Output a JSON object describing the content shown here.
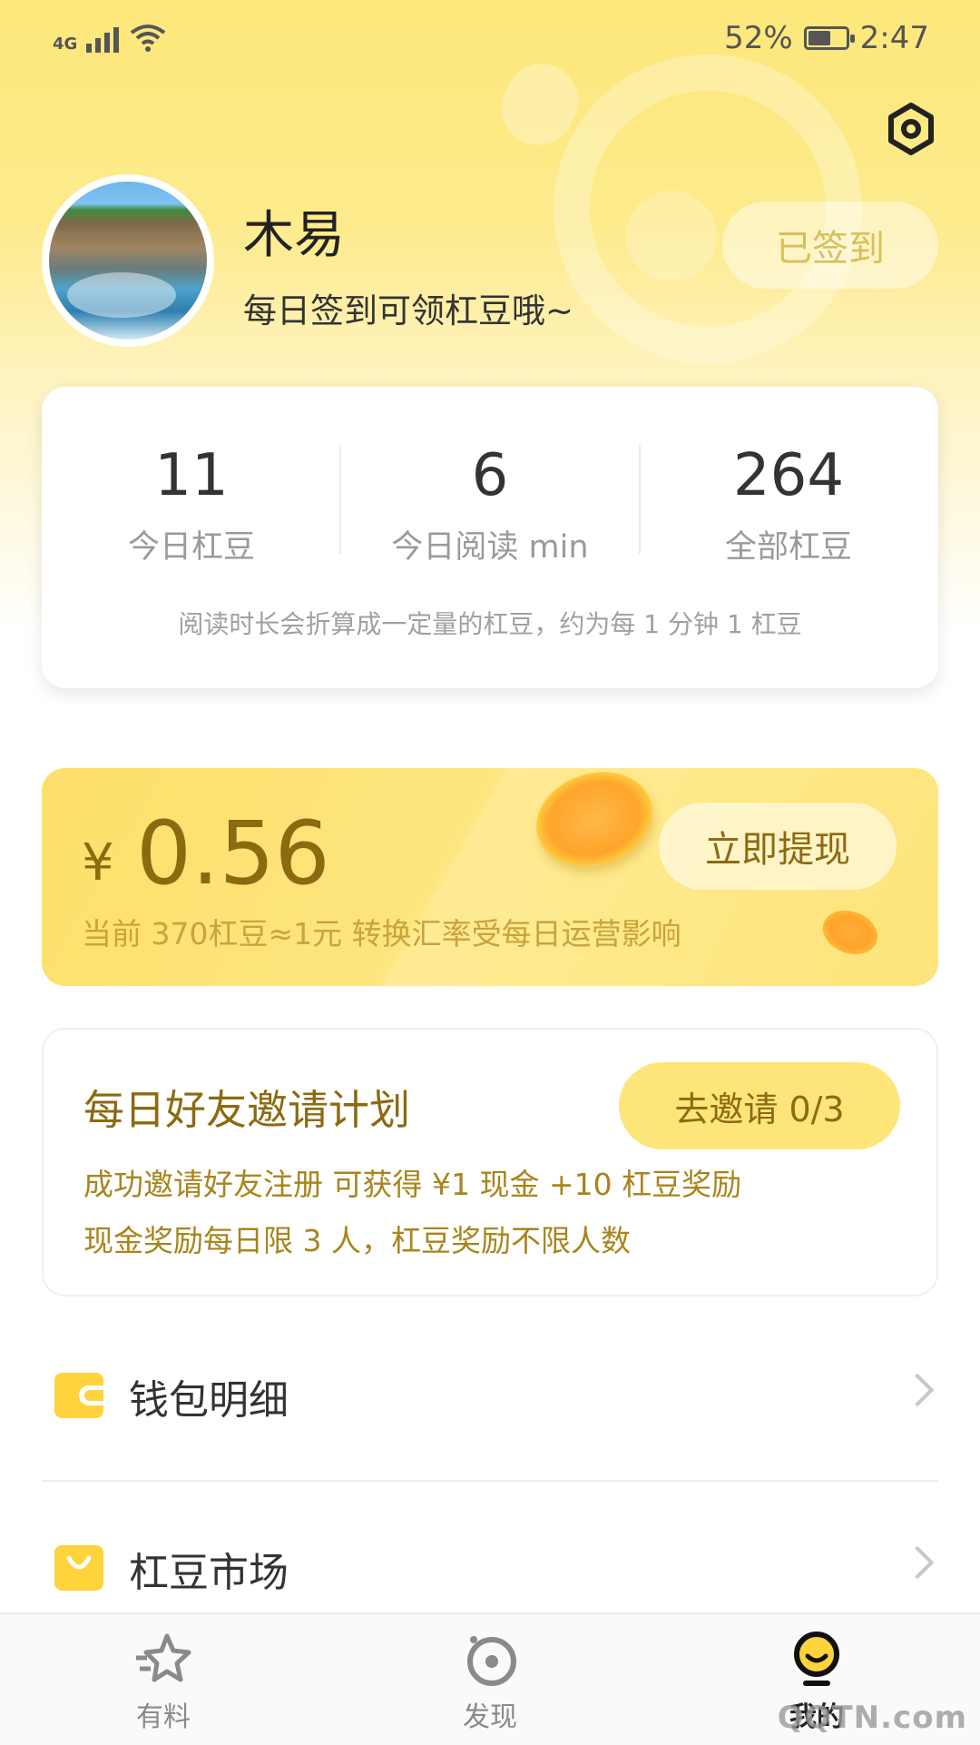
{
  "status_bar": {
    "network": "4G",
    "battery_percent": "52%",
    "time": "2:47",
    "battery_level": 0.52
  },
  "header": {
    "settings_icon": "settings-hexagon-icon"
  },
  "profile": {
    "name": "木易",
    "subtitle": "每日签到可领杠豆哦~",
    "checkin_label": "已签到"
  },
  "stats": {
    "items": [
      {
        "value": "11",
        "label": "今日杠豆"
      },
      {
        "value": "6",
        "label": "今日阅读 min"
      },
      {
        "value": "264",
        "label": "全部杠豆"
      }
    ],
    "note": "阅读时长会折算成一定量的杠豆，约为每 1 分钟 1 杠豆"
  },
  "wallet": {
    "currency": "¥",
    "amount": "0.56",
    "rate_note": "当前 370杠豆≈1元 转换汇率受每日运营影响",
    "withdraw_label": "立即提现"
  },
  "invite": {
    "title": "每日好友邀请计划",
    "button_label": "去邀请 0/3",
    "line1": "成功邀请好友注册 可获得 ¥1 现金 +10 杠豆奖励",
    "line2": "现金奖励每日限 3 人，杠豆奖励不限人数"
  },
  "menu": {
    "items": [
      {
        "label": "钱包明细",
        "icon": "wallet-icon"
      },
      {
        "label": "杠豆市场",
        "icon": "shopping-bag-icon"
      }
    ]
  },
  "bottom_nav": {
    "items": [
      {
        "label": "有料",
        "icon": "star-icon"
      },
      {
        "label": "发现",
        "icon": "discover-icon"
      },
      {
        "label": "我的",
        "icon": "profile-face-icon",
        "active": true
      }
    ]
  },
  "watermark": "QQTN.com",
  "colors": {
    "accent_yellow": "#fde57a",
    "brand_brown": "#8c6a10"
  }
}
